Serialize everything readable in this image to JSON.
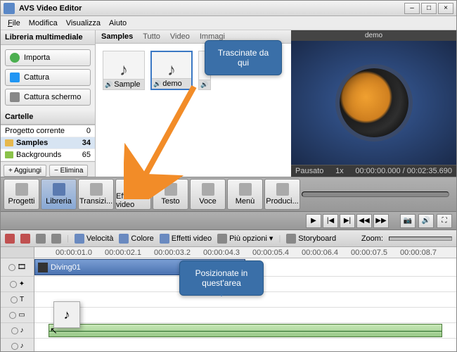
{
  "window": {
    "title": "AVS Video Editor"
  },
  "menu": {
    "file": "File",
    "edit": "Modifica",
    "view": "Visualizza",
    "help": "Aiuto"
  },
  "leftpanel": {
    "header": "Libreria multimediale",
    "import": "Importa",
    "capture": "Cattura",
    "screencap": "Cattura schermo",
    "folders_label": "Cartelle",
    "folders": [
      {
        "name": "Progetto corrente",
        "count": "0"
      },
      {
        "name": "Samples",
        "count": "34"
      },
      {
        "name": "Backgrounds",
        "count": "65"
      }
    ],
    "add": "+ Aggiungi",
    "remove": "− Elimina"
  },
  "midpanel": {
    "title": "Samples",
    "tabs": {
      "all": "Tutto",
      "video": "Video",
      "image": "Immagi"
    },
    "thumbs": [
      {
        "label": "Sample"
      },
      {
        "label": "demo"
      }
    ]
  },
  "tooltip_top": "Trascinate da qui",
  "tooltip_bot": "Posizionate in quest'area",
  "preview": {
    "title": "demo",
    "status": "Pausato",
    "speed": "1x",
    "time": "00:00:00.000 / 00:02:35.690"
  },
  "tabs": {
    "progetti": "Progetti",
    "libreria": "Libreria",
    "transizioni": "Transizi...",
    "effetti": "Effetti video",
    "testo": "Testo",
    "voce": "Voce",
    "menu": "Menù",
    "produci": "Produci..."
  },
  "tl_toolbar": {
    "velocita": "Velocità",
    "colore": "Colore",
    "effetti": "Effetti video",
    "opzioni": "Più opzioni",
    "storyboard": "Storyboard",
    "zoom": "Zoom:"
  },
  "ruler": [
    "00:00:01.0",
    "00:00:02.1",
    "00:00:03.2",
    "00:00:04.3",
    "00:00:05.4",
    "00:00:06.4",
    "00:00:07.5",
    "00:00:08.7"
  ],
  "clip1": "Diving01"
}
